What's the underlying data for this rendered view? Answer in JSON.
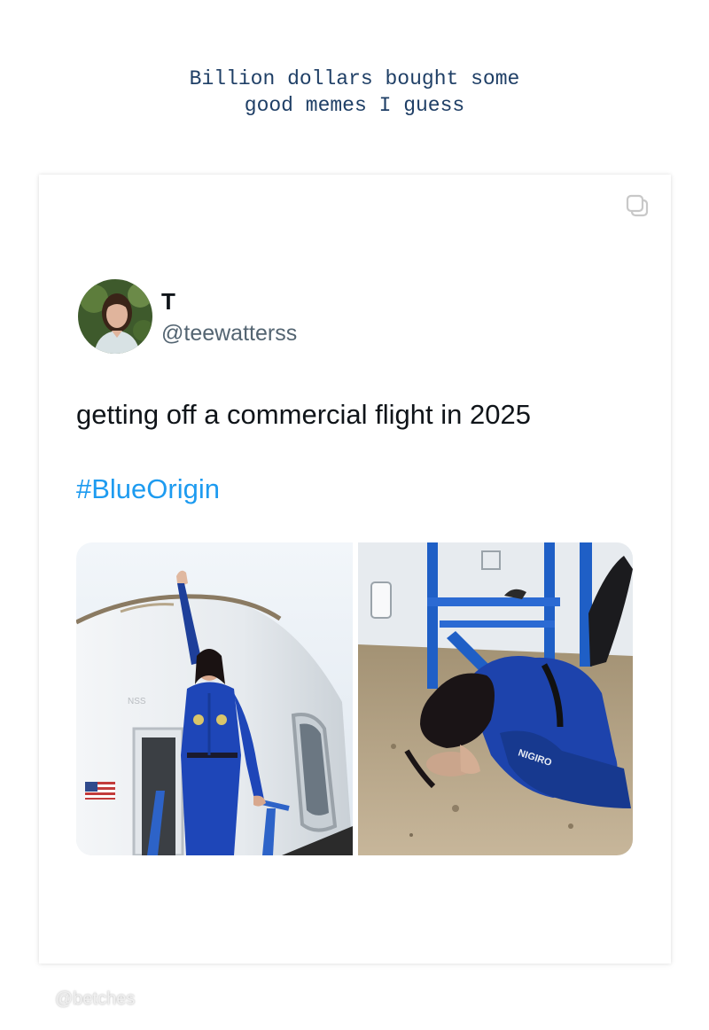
{
  "caption": "Billion dollars bought some\ngood memes I guess",
  "tweet": {
    "display_name": "T",
    "handle": "@teewatterss",
    "text": "getting off a commercial flight in 2025",
    "hashtag": "#BlueOrigin",
    "hashtag_color": "#1d9bf0"
  },
  "images": {
    "left": "astronaut-exiting-capsule",
    "right": "astronaut-kissing-ground"
  },
  "icons": {
    "copy": "copy-icon",
    "flag": "us-flag-icon"
  },
  "watermark": "@betches"
}
